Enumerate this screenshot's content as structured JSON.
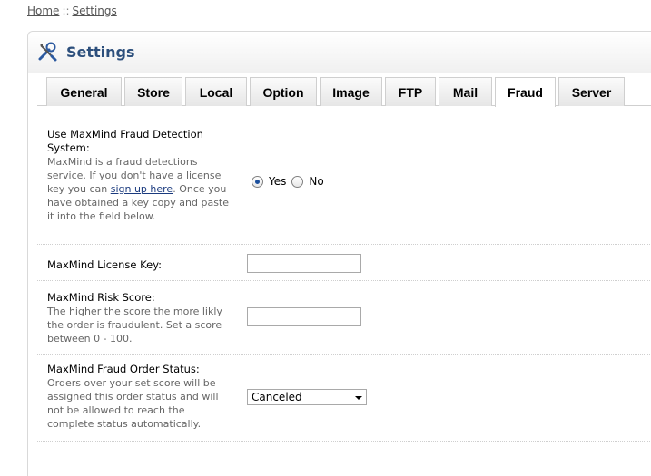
{
  "breadcrumb": {
    "home": "Home",
    "separator": "::",
    "current": "Settings"
  },
  "heading": {
    "title": "Settings",
    "icon": "tools-icon"
  },
  "tabs": [
    {
      "label": "General"
    },
    {
      "label": "Store"
    },
    {
      "label": "Local"
    },
    {
      "label": "Option"
    },
    {
      "label": "Image"
    },
    {
      "label": "FTP"
    },
    {
      "label": "Mail"
    },
    {
      "label": "Fraud"
    },
    {
      "label": "Server"
    }
  ],
  "active_tab": "Fraud",
  "fields": {
    "maxmind_system": {
      "label": "Use MaxMind Fraud Detection System:",
      "help_before": "MaxMind is a fraud detections service. If you don't have a license key you can ",
      "help_link": "sign up here",
      "help_after": ". Once you have obtained a key copy and paste it into the field below.",
      "option_yes": "Yes",
      "option_no": "No",
      "selected": "Yes"
    },
    "license_key": {
      "label": "MaxMind License Key:",
      "value": ""
    },
    "risk_score": {
      "label": "MaxMind Risk Score:",
      "help": "The higher the score the more likly the order is fraudulent. Set a score between 0 - 100.",
      "value": ""
    },
    "order_status": {
      "label": "MaxMind Fraud Order Status:",
      "help": "Orders over your set score will be assigned this order status and will not be allowed to reach the complete status automatically.",
      "selected": "Canceled"
    }
  }
}
